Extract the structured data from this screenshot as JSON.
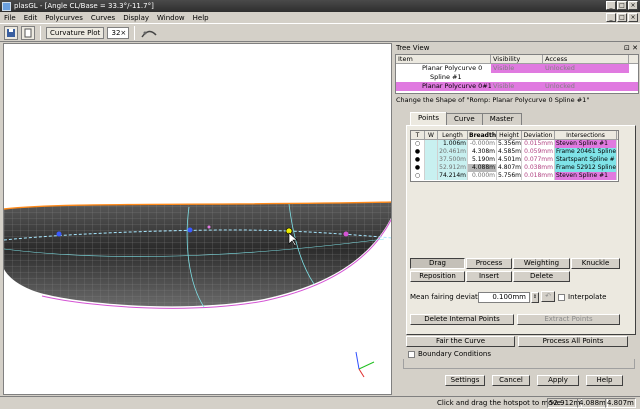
{
  "window": {
    "title": "plasGL - [Angle CL/Base = 33.3°/-11.7°]",
    "controls": [
      "_",
      "□",
      "×"
    ]
  },
  "menu": [
    "File",
    "Edit",
    "Polycurves",
    "Curves",
    "Display",
    "Window",
    "Help"
  ],
  "toolbar": {
    "curvature_label": "Curvature Plot",
    "zoom_value": "32×"
  },
  "tree_view": {
    "title": "Tree View",
    "columns": [
      "Item",
      "Visibility",
      "Access"
    ],
    "rows": [
      {
        "item": "Planar Polycurve 0",
        "visibility": "Visible",
        "access": "Unlocked"
      },
      {
        "item": "Spline #1",
        "visibility": "",
        "access": ""
      },
      {
        "item": "Planar Polycurve 0#1",
        "visibility": "Visible",
        "access": "Unlocked"
      }
    ]
  },
  "dialog": {
    "title": "Change the Shape of \"Romp: Planar Polycurve 0 Spline #1\"",
    "tabs": [
      "Points",
      "Curve",
      "Master"
    ],
    "active_tab": "Points",
    "columns": [
      "T",
      "W",
      "Length",
      "Breadth",
      "Height",
      "Deviation",
      "Intersections"
    ],
    "rows": [
      {
        "t": "○",
        "w": "",
        "length": "1.006m",
        "breadth": "-0.000m",
        "height": "5.356m",
        "deviation": "0.015mm",
        "intersection": "Steven Spline #1"
      },
      {
        "t": "●",
        "w": "",
        "length": "20.461m",
        "breadth": "4.308m",
        "height": "4.585m",
        "deviation": "0.059mm",
        "intersection": "Frame 20461 Spline"
      },
      {
        "t": "●",
        "w": "",
        "length": "37.500m",
        "breadth": "5.190m",
        "height": "4.501m",
        "deviation": "0.077mm",
        "intersection": "Startspant Spline #"
      },
      {
        "t": "●",
        "w": "",
        "length": "52.912m",
        "breadth": "4.088m",
        "height": "4.807m",
        "deviation": "0.038mm",
        "intersection": "Frame 52912 Spline"
      },
      {
        "t": "○",
        "w": "",
        "length": "74.214m",
        "breadth": "0.000m",
        "height": "5.756m",
        "deviation": "0.018mm",
        "intersection": "Steven Spline #1"
      }
    ],
    "mode_buttons": [
      "Drag",
      "Process",
      "Weighting",
      "Knuckle",
      "Reposition",
      "Insert",
      "Delete"
    ],
    "mean_fairing_label": "Mean fairing deviation:",
    "mean_fairing_value": "0.100mm",
    "interpolate_label": "Interpolate",
    "delete_internal_label": "Delete Internal Points",
    "extract_points_label": "Extract Points",
    "fair_curve_label": "Fair the Curve",
    "process_all_label": "Process All Points",
    "boundary_label": "Boundary Conditions",
    "settings_label": "Settings",
    "cancel_label": "Cancel",
    "apply_label": "Apply",
    "help_label": "Help"
  },
  "status": {
    "message": "Click and drag the hotspot to move.",
    "length": "52.912m",
    "breadth": "4.088m",
    "height": "4.807m"
  },
  "colors": {
    "highlight_cyan": "#7fe3e8",
    "highlight_magenta": "#e07ae0",
    "hull_dark": "#3a3a3a",
    "edge_orange": "#ff8a1a"
  }
}
